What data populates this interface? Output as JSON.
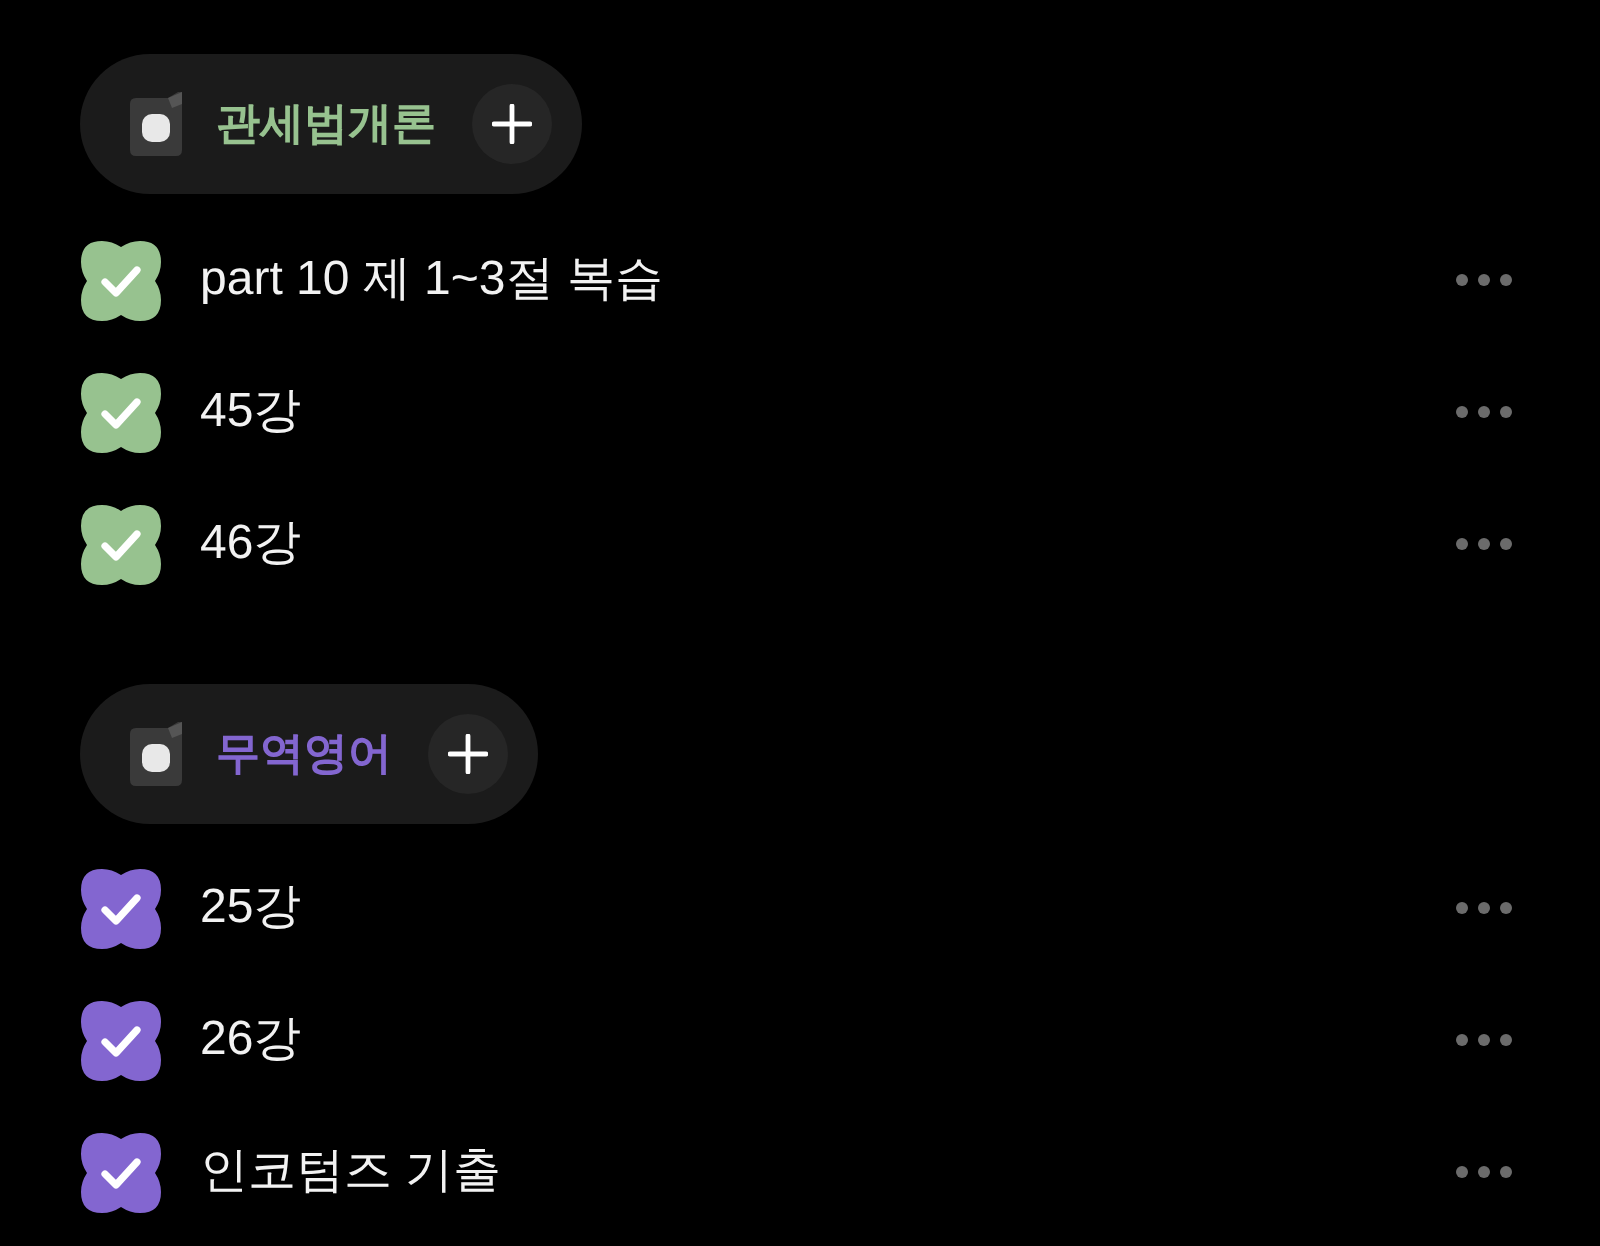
{
  "groups": [
    {
      "title": "관세법개론",
      "color": "#97c28f",
      "items": [
        {
          "label": "part 10 제 1~3절 복습",
          "checked": true
        },
        {
          "label": "45강",
          "checked": true
        },
        {
          "label": "46강",
          "checked": true
        }
      ]
    },
    {
      "title": "무역영어",
      "color": "#8366d0",
      "items": [
        {
          "label": "25강",
          "checked": true
        },
        {
          "label": "26강",
          "checked": true
        },
        {
          "label": "인코텀즈 기출",
          "checked": true
        }
      ]
    }
  ]
}
